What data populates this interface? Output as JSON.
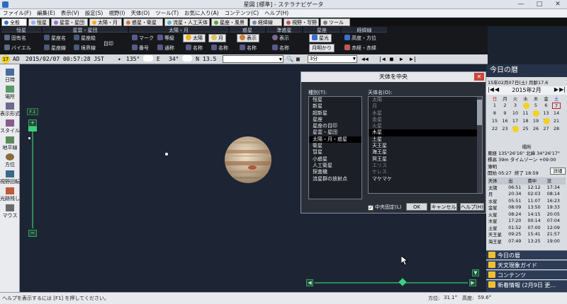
{
  "window": {
    "title": "星図 [標準] - ステラナビゲータ",
    "controls": [
      "—",
      "□",
      "✕"
    ]
  },
  "menu": [
    "ファイル(F)",
    "編集(E)",
    "表示(V)",
    "設定(S)",
    "視野(I)",
    "天体(O)",
    "ツール(T)",
    "お気に入り(A)",
    "コンテンツ(C)",
    "ヘルプ(H)"
  ],
  "tabs": [
    "全般",
    "恒星",
    "星雲・星団",
    "太陽・月",
    "惑星・衛星",
    "流星・人工天体",
    "星座・風景",
    "経緯線",
    "視野・写野",
    "ツール"
  ],
  "ribbon": {
    "groups": [
      "恒星",
      "星雲・星団",
      "太陽・月",
      "惑星",
      "準惑星",
      "星座",
      "経緯線"
    ],
    "items": {
      "common_name": "固有名",
      "bayer": "バイエル",
      "const_name": "星座名",
      "const_line": "星座線",
      "const_fig": "星座絵",
      "boundary": "境界線",
      "catalog": "目印",
      "mark": "マーク",
      "number": "番号",
      "limit_mag": "等級",
      "limit_mag2": "通称",
      "sun": "太陽",
      "moon": "月",
      "sm_name": "名称",
      "sm_name2": "名称",
      "planet_show": "表示",
      "planet_name": "名称",
      "dwarf_show": "表示",
      "dwarf_name": "名称",
      "const_btn1": "星光",
      "const_btn2": "月明かり",
      "alt_az": "高度・方位",
      "ecliptic": "赤経・赤緯"
    }
  },
  "timebar": {
    "badge": "17",
    "era": "AD",
    "datetime": "2015/02/07 00:57:28 JST",
    "lon_deg": "135",
    "lon_dir": "E",
    "lat_deg": "34",
    "lat_dir": "N",
    "fov": "13.5",
    "search_value": "",
    "speed": "3分"
  },
  "left_toolbar": [
    "日時",
    "場所",
    "表示形式",
    "スタイル",
    "地平線",
    "方位",
    "視野回転",
    "光跡残し",
    "マウス"
  ],
  "zoom_label": "F.1",
  "dialog": {
    "title": "天体を中央",
    "category_label": "種別(T):",
    "object_label": "天体名(O):",
    "categories": [
      "恒星",
      "新星",
      "超新星",
      "星座",
      "星座の目印",
      "星雲・星団",
      "太陽・月・惑星",
      "衛星",
      "彗星",
      "小惑星",
      "人工衛星",
      "探査機",
      "流星群の放射点"
    ],
    "selected_category": "太陽・月・惑星",
    "objects": [
      "太陽",
      "月",
      "水星",
      "金星",
      "火星",
      "木星",
      "土星",
      "天王星",
      "海王星",
      "冥王星",
      "エリス",
      "ケレス",
      "マケマケ"
    ],
    "selected_object": "木星",
    "lock_label": "中央固定(L)",
    "ok": "OK",
    "cancel": "キャンセル",
    "help": "ヘルプ(H)"
  },
  "right_panel": {
    "title": "今日の暦",
    "date_line": "15年02月07日(土)  月齢17.6",
    "month": "2015年2月",
    "weekdays": [
      "日",
      "月",
      "火",
      "水",
      "木",
      "金",
      "土"
    ],
    "calendar_rows": [
      [
        "1",
        "2",
        "3",
        "4",
        "5",
        "6",
        "7"
      ],
      [
        "8",
        "9",
        "10",
        "11",
        "12",
        "13",
        "14"
      ],
      [
        "15",
        "16",
        "17",
        "18",
        "19",
        "20",
        "21"
      ],
      [
        "22",
        "23",
        "24",
        "25",
        "26",
        "27",
        "28"
      ]
    ],
    "place_label": "場所",
    "coords": "東経 135°26'16\"  北緯 34°26'17\"",
    "elev": "標高 39m   タイムゾーン +09:00",
    "twilight_label": "薄明",
    "twilight_start": "開始 05:27",
    "twilight_end": "終了 18:59",
    "detail_btn": "詳細",
    "rise_headers": [
      "天体",
      "出",
      "南中",
      "没"
    ],
    "rise_rows": [
      [
        "太陽",
        "06:51",
        "12:12",
        "17:34"
      ],
      [
        "月",
        "20:34",
        "02:03",
        "08:14"
      ],
      [
        "水星",
        "05:51",
        "11:07",
        "16:23"
      ],
      [
        "金星",
        "08:09",
        "13:50",
        "19:33"
      ],
      [
        "火星",
        "08:24",
        "14:15",
        "20:05"
      ],
      [
        "木星",
        "17:20",
        "00:14",
        "07:04"
      ],
      [
        "土星",
        "01:52",
        "07:00",
        "12:09"
      ],
      [
        "天王星",
        "09:25",
        "15:41",
        "21:57"
      ],
      [
        "海王星",
        "07:49",
        "13:25",
        "19:00"
      ]
    ],
    "nav": [
      "今日の暦",
      "天文現象ガイド",
      "コンテンツ",
      "新着情報 (2月9日 更..."
    ]
  },
  "statusbar": {
    "help": "ヘルプを表示するには [F1] を押してください。",
    "azimuth_label": "方位:",
    "azimuth": "31.1°",
    "altitude_label": "高度:",
    "altitude": "59.6°"
  }
}
